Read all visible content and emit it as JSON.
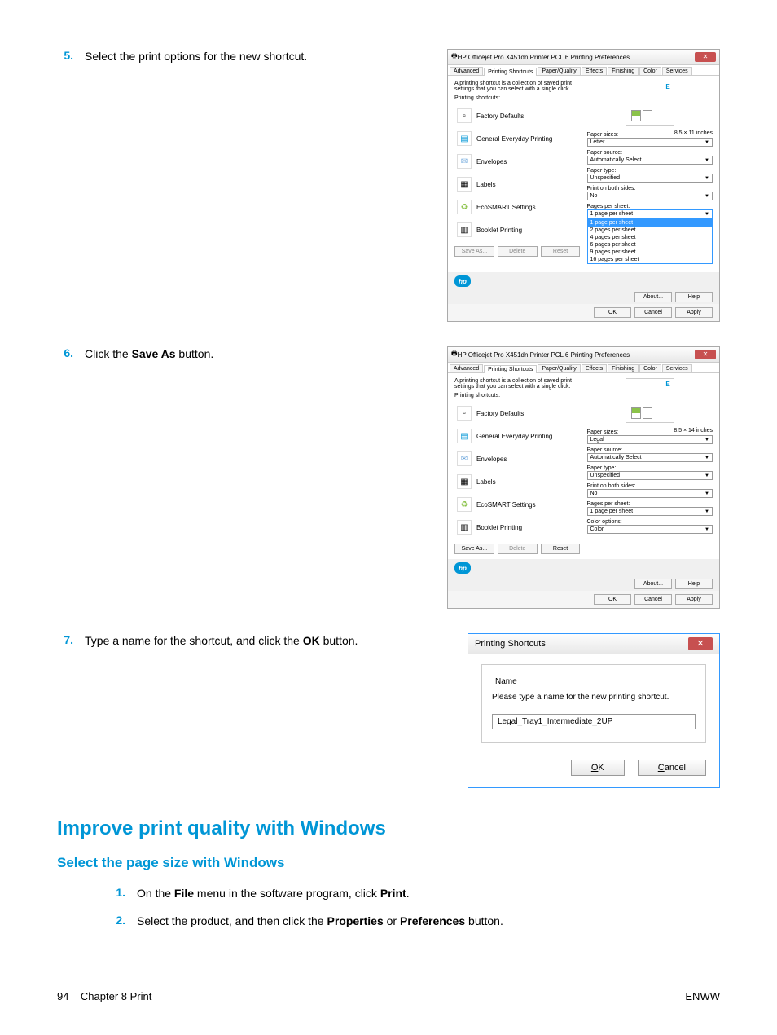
{
  "steps": {
    "s5": {
      "num": "5.",
      "text": "Select the print options for the new shortcut."
    },
    "s6": {
      "num": "6.",
      "text_pre": "Click the ",
      "bold": "Save As",
      "text_post": " button."
    },
    "s7": {
      "num": "7.",
      "text_pre": "Type a name for the shortcut, and click the ",
      "bold": "OK",
      "text_post": " button."
    }
  },
  "dlg1": {
    "title": "HP Officejet Pro X451dn Printer PCL 6 Printing Preferences",
    "tabs": [
      "Advanced",
      "Printing Shortcuts",
      "Paper/Quality",
      "Effects",
      "Finishing",
      "Color",
      "Services"
    ],
    "desc": "A printing shortcut is a collection of saved print settings that you can select with a single click.",
    "list_label": "Printing shortcuts:",
    "shortcuts": [
      "Factory Defaults",
      "General Everyday Printing",
      "Envelopes",
      "Labels",
      "EcoSMART Settings",
      "Booklet Printing"
    ],
    "btns": {
      "saveas": "Save As...",
      "delete": "Delete",
      "reset": "Reset"
    },
    "fields": {
      "papersizes": {
        "label": "Paper sizes:",
        "info": "8.5 × 11 inches",
        "value": "Letter"
      },
      "papersource": {
        "label": "Paper source:",
        "value": "Automatically Select"
      },
      "papertype": {
        "label": "Paper type:",
        "value": "Unspecified"
      },
      "both": {
        "label": "Print on both sides:",
        "value": "No"
      },
      "pps": {
        "label": "Pages per sheet:",
        "value": "1 page per sheet"
      }
    },
    "dropdown": [
      "1 page per sheet",
      "2 pages per sheet",
      "4 pages per sheet",
      "6 pages per sheet",
      "9 pages per sheet",
      "16 pages per sheet"
    ],
    "footer_about": {
      "about": "About...",
      "help": "Help"
    },
    "footer": {
      "ok": "OK",
      "cancel": "Cancel",
      "apply": "Apply"
    }
  },
  "dlg2": {
    "title": "HP Officejet Pro X451dn Printer PCL 6 Printing Preferences",
    "fields": {
      "papersizes": {
        "label": "Paper sizes:",
        "info": "8.5 × 14 inches",
        "value": "Legal"
      },
      "papersource": {
        "label": "Paper source:",
        "value": "Automatically Select"
      },
      "papertype": {
        "label": "Paper type:",
        "value": "Unspecified"
      },
      "both": {
        "label": "Print on both sides:",
        "value": "No"
      },
      "pps": {
        "label": "Pages per sheet:",
        "value": "1 page per sheet"
      },
      "coloropt": {
        "label": "Color options:",
        "value": "Color"
      }
    }
  },
  "name_dlg": {
    "title": "Printing Shortcuts",
    "fieldset_label": "Name",
    "desc": "Please type a name for the new printing shortcut.",
    "value": "Legal_Tray1_Intermediate_2UP",
    "ok": "OK",
    "cancel": "Cancel"
  },
  "headings": {
    "h2": "Improve print quality with Windows",
    "h3": "Select the page size with Windows"
  },
  "substeps": {
    "s1": {
      "num": "1.",
      "pre": "On the ",
      "b1": "File",
      "mid": " menu in the software program, click ",
      "b2": "Print",
      "post": "."
    },
    "s2": {
      "num": "2.",
      "pre": "Select the product, and then click the ",
      "b1": "Properties",
      "mid": " or ",
      "b2": "Preferences",
      "post": " button."
    }
  },
  "footer": {
    "page": "94",
    "chapter": "Chapter 8   Print",
    "lang": "ENWW"
  }
}
